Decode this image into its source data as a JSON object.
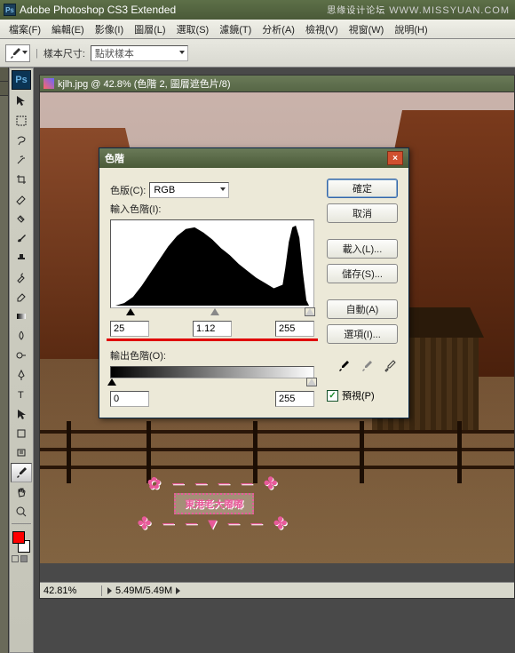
{
  "app": {
    "title": "Adobe Photoshop CS3 Extended",
    "watermark_cn": "思缘设计论坛",
    "watermark_en": "WWW.MISSYUAN.COM"
  },
  "menu": {
    "file": "檔案(F)",
    "edit": "編輯(E)",
    "image": "影像(I)",
    "layer": "圖層(L)",
    "select": "選取(S)",
    "filter": "濾鏡(T)",
    "analysis": "分析(A)",
    "view": "檢視(V)",
    "window": "視窗(W)",
    "help": "說明(H)"
  },
  "options": {
    "sample_size_label": "樣本尺寸:",
    "sample_value": "點狀樣本"
  },
  "document": {
    "title": "kjlh.jpg @ 42.8% (色階 2, 圖層遮色片/8)",
    "zoom": "42.81%",
    "status": "5.49M/5.49M"
  },
  "swatches": {
    "fg": "#ff0000",
    "bg": "#ffffff"
  },
  "pink_stamp": {
    "deco_top": "✿ ─ ─ ─ ─ ✤",
    "text": "東港老大嘟嘟",
    "deco_bottom": "✤ ─ ─ ▾ ─ ─ ✤"
  },
  "levels": {
    "title": "色階",
    "channel_label": "色版(C):",
    "channel_value": "RGB",
    "input_label": "輸入色階(I):",
    "input_black": "25",
    "input_gamma": "1.12",
    "input_white": "255",
    "output_label": "輸出色階(O):",
    "output_black": "0",
    "output_white": "255",
    "buttons": {
      "ok": "確定",
      "cancel": "取消",
      "load": "載入(L)...",
      "save": "儲存(S)...",
      "auto": "自動(A)",
      "options": "選項(I)..."
    },
    "preview_label": "預視(P)",
    "preview_checked": true
  }
}
